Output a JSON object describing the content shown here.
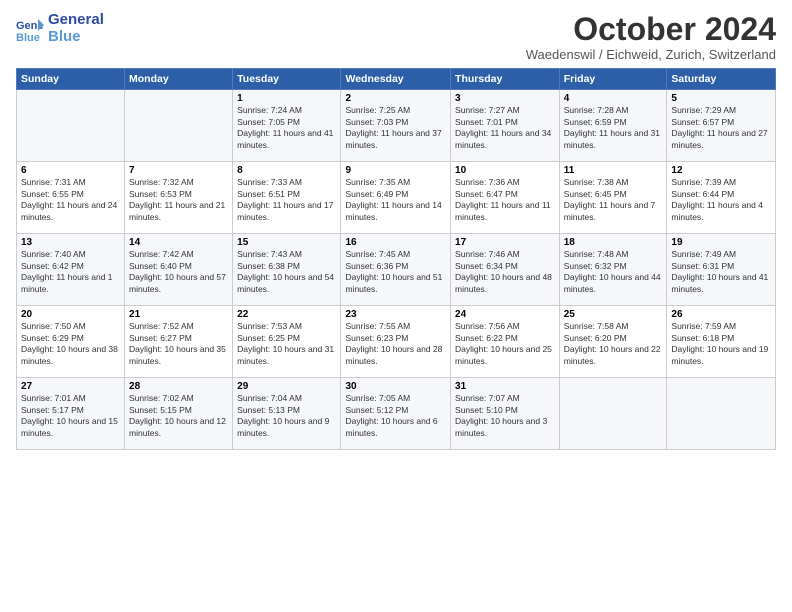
{
  "header": {
    "logo_line1": "General",
    "logo_line2": "Blue",
    "month_title": "October 2024",
    "location": "Waedenswil / Eichweid, Zurich, Switzerland"
  },
  "weekdays": [
    "Sunday",
    "Monday",
    "Tuesday",
    "Wednesday",
    "Thursday",
    "Friday",
    "Saturday"
  ],
  "weeks": [
    [
      {
        "day": "",
        "info": ""
      },
      {
        "day": "",
        "info": ""
      },
      {
        "day": "1",
        "info": "Sunrise: 7:24 AM\nSunset: 7:05 PM\nDaylight: 11 hours and 41 minutes."
      },
      {
        "day": "2",
        "info": "Sunrise: 7:25 AM\nSunset: 7:03 PM\nDaylight: 11 hours and 37 minutes."
      },
      {
        "day": "3",
        "info": "Sunrise: 7:27 AM\nSunset: 7:01 PM\nDaylight: 11 hours and 34 minutes."
      },
      {
        "day": "4",
        "info": "Sunrise: 7:28 AM\nSunset: 6:59 PM\nDaylight: 11 hours and 31 minutes."
      },
      {
        "day": "5",
        "info": "Sunrise: 7:29 AM\nSunset: 6:57 PM\nDaylight: 11 hours and 27 minutes."
      }
    ],
    [
      {
        "day": "6",
        "info": "Sunrise: 7:31 AM\nSunset: 6:55 PM\nDaylight: 11 hours and 24 minutes."
      },
      {
        "day": "7",
        "info": "Sunrise: 7:32 AM\nSunset: 6:53 PM\nDaylight: 11 hours and 21 minutes."
      },
      {
        "day": "8",
        "info": "Sunrise: 7:33 AM\nSunset: 6:51 PM\nDaylight: 11 hours and 17 minutes."
      },
      {
        "day": "9",
        "info": "Sunrise: 7:35 AM\nSunset: 6:49 PM\nDaylight: 11 hours and 14 minutes."
      },
      {
        "day": "10",
        "info": "Sunrise: 7:36 AM\nSunset: 6:47 PM\nDaylight: 11 hours and 11 minutes."
      },
      {
        "day": "11",
        "info": "Sunrise: 7:38 AM\nSunset: 6:45 PM\nDaylight: 11 hours and 7 minutes."
      },
      {
        "day": "12",
        "info": "Sunrise: 7:39 AM\nSunset: 6:44 PM\nDaylight: 11 hours and 4 minutes."
      }
    ],
    [
      {
        "day": "13",
        "info": "Sunrise: 7:40 AM\nSunset: 6:42 PM\nDaylight: 11 hours and 1 minute."
      },
      {
        "day": "14",
        "info": "Sunrise: 7:42 AM\nSunset: 6:40 PM\nDaylight: 10 hours and 57 minutes."
      },
      {
        "day": "15",
        "info": "Sunrise: 7:43 AM\nSunset: 6:38 PM\nDaylight: 10 hours and 54 minutes."
      },
      {
        "day": "16",
        "info": "Sunrise: 7:45 AM\nSunset: 6:36 PM\nDaylight: 10 hours and 51 minutes."
      },
      {
        "day": "17",
        "info": "Sunrise: 7:46 AM\nSunset: 6:34 PM\nDaylight: 10 hours and 48 minutes."
      },
      {
        "day": "18",
        "info": "Sunrise: 7:48 AM\nSunset: 6:32 PM\nDaylight: 10 hours and 44 minutes."
      },
      {
        "day": "19",
        "info": "Sunrise: 7:49 AM\nSunset: 6:31 PM\nDaylight: 10 hours and 41 minutes."
      }
    ],
    [
      {
        "day": "20",
        "info": "Sunrise: 7:50 AM\nSunset: 6:29 PM\nDaylight: 10 hours and 38 minutes."
      },
      {
        "day": "21",
        "info": "Sunrise: 7:52 AM\nSunset: 6:27 PM\nDaylight: 10 hours and 35 minutes."
      },
      {
        "day": "22",
        "info": "Sunrise: 7:53 AM\nSunset: 6:25 PM\nDaylight: 10 hours and 31 minutes."
      },
      {
        "day": "23",
        "info": "Sunrise: 7:55 AM\nSunset: 6:23 PM\nDaylight: 10 hours and 28 minutes."
      },
      {
        "day": "24",
        "info": "Sunrise: 7:56 AM\nSunset: 6:22 PM\nDaylight: 10 hours and 25 minutes."
      },
      {
        "day": "25",
        "info": "Sunrise: 7:58 AM\nSunset: 6:20 PM\nDaylight: 10 hours and 22 minutes."
      },
      {
        "day": "26",
        "info": "Sunrise: 7:59 AM\nSunset: 6:18 PM\nDaylight: 10 hours and 19 minutes."
      }
    ],
    [
      {
        "day": "27",
        "info": "Sunrise: 7:01 AM\nSunset: 5:17 PM\nDaylight: 10 hours and 15 minutes."
      },
      {
        "day": "28",
        "info": "Sunrise: 7:02 AM\nSunset: 5:15 PM\nDaylight: 10 hours and 12 minutes."
      },
      {
        "day": "29",
        "info": "Sunrise: 7:04 AM\nSunset: 5:13 PM\nDaylight: 10 hours and 9 minutes."
      },
      {
        "day": "30",
        "info": "Sunrise: 7:05 AM\nSunset: 5:12 PM\nDaylight: 10 hours and 6 minutes."
      },
      {
        "day": "31",
        "info": "Sunrise: 7:07 AM\nSunset: 5:10 PM\nDaylight: 10 hours and 3 minutes."
      },
      {
        "day": "",
        "info": ""
      },
      {
        "day": "",
        "info": ""
      }
    ]
  ]
}
